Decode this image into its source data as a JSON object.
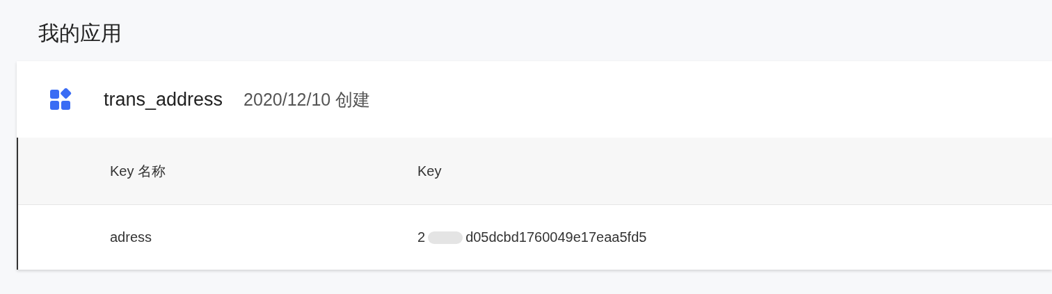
{
  "page_title": "我的应用",
  "app": {
    "name": "trans_address",
    "created": "2020/12/10 创建"
  },
  "table": {
    "columns": [
      "Key 名称",
      "Key"
    ],
    "rows": [
      {
        "key_name": "adress",
        "key": {
          "prefix": "2",
          "suffix": "d05dcbd1760049e17eaa5fd5",
          "redacted": true
        }
      }
    ]
  }
}
